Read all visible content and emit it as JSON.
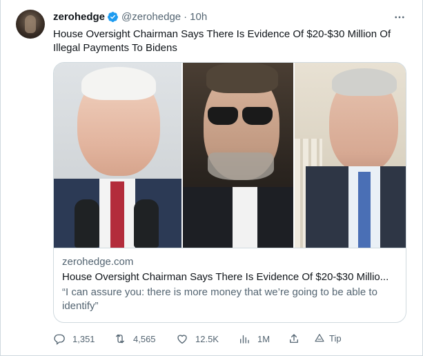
{
  "tweet": {
    "author_name": "zerohedge",
    "handle": "@zerohedge",
    "separator": "·",
    "time": "10h",
    "text": "House Oversight Chairman Says There Is Evidence Of $20-$30 Million Of Illegal Payments To Bidens"
  },
  "card": {
    "domain": "zerohedge.com",
    "title": "House Oversight Chairman Says There Is Evidence Of $20-$30 Millio...",
    "description": "“I can assure you: there is more money that we’re going to be able to identify”"
  },
  "actions": {
    "replies": "1,351",
    "retweets": "4,565",
    "likes": "12.5K",
    "views": "1M",
    "tip_label": "Tip"
  },
  "colors": {
    "text_primary": "#0f1419",
    "text_secondary": "#536471",
    "verified_blue": "#1d9bf0",
    "border": "#cfd9de"
  },
  "icons": [
    "more-icon",
    "verified-badge-icon",
    "reply-icon",
    "retweet-icon",
    "like-icon",
    "views-icon",
    "share-icon",
    "tip-icon"
  ]
}
